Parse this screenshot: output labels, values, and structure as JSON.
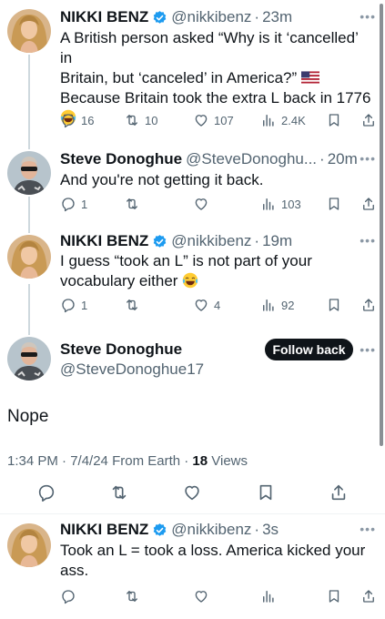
{
  "tweets": [
    {
      "name": "NIKKI BENZ",
      "handle": "@nikkibenz",
      "time": "23m",
      "line1": "A British person asked “Why is it ‘cancelled’ in",
      "line2": "Britain, but ‘canceled’ in America?”",
      "line3": "Because Britain took the extra L back in 1776",
      "replies": "16",
      "retweets": "10",
      "likes": "107",
      "views": "2.4K"
    },
    {
      "name": "Steve Donoghue",
      "handle": "@SteveDonoghu...",
      "time": "20m",
      "line1": "And you're not getting it back.",
      "replies": "1",
      "retweets": "",
      "likes": "",
      "views": "103"
    },
    {
      "name": "NIKKI BENZ",
      "handle": "@nikkibenz",
      "time": "19m",
      "line1": "I guess “took an L” is not part of your",
      "line2": "vocabulary either",
      "replies": "1",
      "retweets": "",
      "likes": "4",
      "views": "92"
    }
  ],
  "main_tweet": {
    "name": "Steve Donoghue",
    "handle": "@SteveDonoghue17",
    "follow_label": "Follow back",
    "text": "Nope",
    "time_date": "1:34 PM · 7/4/24 From Earth · ",
    "views_count": "18",
    "views_label": " Views"
  },
  "reply": {
    "name": "NIKKI BENZ",
    "handle": "@nikkibenz",
    "time": "3s",
    "line1": "Took an L = took a loss. America kicked your",
    "line2": "ass."
  },
  "colors": {
    "accent": "#1d9bf0",
    "text": "#0f1419",
    "muted": "#536471",
    "follow_bg": "#0f1419"
  },
  "icons": [
    "reply-icon",
    "retweet-icon",
    "like-icon",
    "views-icon",
    "bookmark-icon",
    "share-icon",
    "verified-icon",
    "more-icon",
    "laughing-emoji",
    "us-flag-emoji"
  ]
}
